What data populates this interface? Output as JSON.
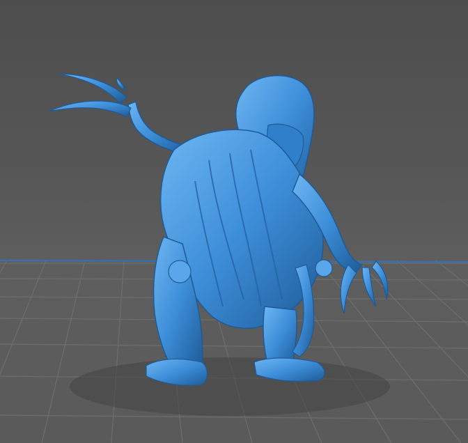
{
  "viewport": {
    "title": "",
    "background_top": "#4d4d4d",
    "background_bottom": "#5a5a5a",
    "grid_color": "#6e6e6e",
    "axis_x_color": "#2f73c0",
    "model_color": "#3d8ed9",
    "model_highlight": "#6fb6f2",
    "model_shadow": "#1e5b97",
    "model_name": "hooded-clawed-creature-miniature"
  }
}
